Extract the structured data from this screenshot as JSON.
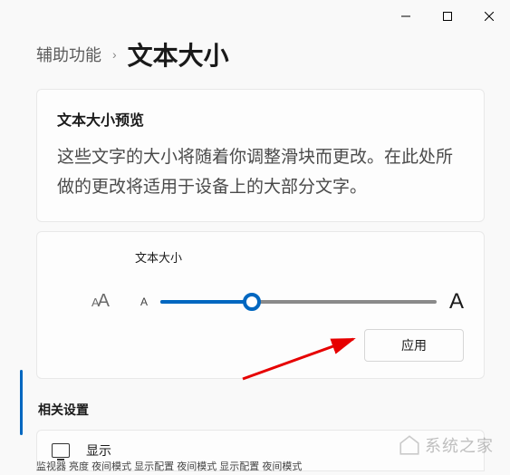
{
  "titlebar": {
    "min": "minimize",
    "max": "maximize",
    "close": "close"
  },
  "breadcrumb": {
    "parent": "辅助功能",
    "sep": "›",
    "current": "文本大小"
  },
  "preview": {
    "title": "文本大小预览",
    "body": "这些文字的大小将随着你调整滑块而更改。在此处所做的更改将适用于设备上的大部分文字。"
  },
  "slider": {
    "label": "文本大小",
    "small": "A",
    "big": "A",
    "percent": 33,
    "apply": "应用"
  },
  "related": {
    "heading": "相关设置",
    "display": "显示"
  },
  "footer": "监视器    亮度    夜间模式    显示配置    夜间模式    显示配置    夜间模式",
  "watermark": "系统之家"
}
